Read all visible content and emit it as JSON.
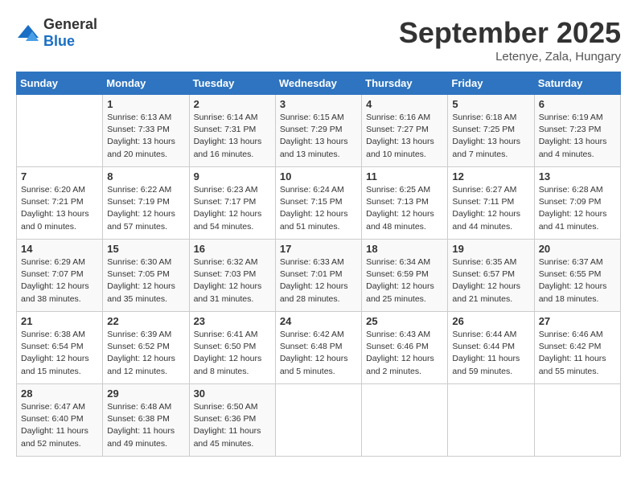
{
  "logo": {
    "general": "General",
    "blue": "Blue"
  },
  "header": {
    "month": "September 2025",
    "location": "Letenye, Zala, Hungary"
  },
  "weekdays": [
    "Sunday",
    "Monday",
    "Tuesday",
    "Wednesday",
    "Thursday",
    "Friday",
    "Saturday"
  ],
  "weeks": [
    [
      {
        "day": null,
        "info": null
      },
      {
        "day": "1",
        "info": "Sunrise: 6:13 AM\nSunset: 7:33 PM\nDaylight: 13 hours\nand 20 minutes."
      },
      {
        "day": "2",
        "info": "Sunrise: 6:14 AM\nSunset: 7:31 PM\nDaylight: 13 hours\nand 16 minutes."
      },
      {
        "day": "3",
        "info": "Sunrise: 6:15 AM\nSunset: 7:29 PM\nDaylight: 13 hours\nand 13 minutes."
      },
      {
        "day": "4",
        "info": "Sunrise: 6:16 AM\nSunset: 7:27 PM\nDaylight: 13 hours\nand 10 minutes."
      },
      {
        "day": "5",
        "info": "Sunrise: 6:18 AM\nSunset: 7:25 PM\nDaylight: 13 hours\nand 7 minutes."
      },
      {
        "day": "6",
        "info": "Sunrise: 6:19 AM\nSunset: 7:23 PM\nDaylight: 13 hours\nand 4 minutes."
      }
    ],
    [
      {
        "day": "7",
        "info": "Sunrise: 6:20 AM\nSunset: 7:21 PM\nDaylight: 13 hours\nand 0 minutes."
      },
      {
        "day": "8",
        "info": "Sunrise: 6:22 AM\nSunset: 7:19 PM\nDaylight: 12 hours\nand 57 minutes."
      },
      {
        "day": "9",
        "info": "Sunrise: 6:23 AM\nSunset: 7:17 PM\nDaylight: 12 hours\nand 54 minutes."
      },
      {
        "day": "10",
        "info": "Sunrise: 6:24 AM\nSunset: 7:15 PM\nDaylight: 12 hours\nand 51 minutes."
      },
      {
        "day": "11",
        "info": "Sunrise: 6:25 AM\nSunset: 7:13 PM\nDaylight: 12 hours\nand 48 minutes."
      },
      {
        "day": "12",
        "info": "Sunrise: 6:27 AM\nSunset: 7:11 PM\nDaylight: 12 hours\nand 44 minutes."
      },
      {
        "day": "13",
        "info": "Sunrise: 6:28 AM\nSunset: 7:09 PM\nDaylight: 12 hours\nand 41 minutes."
      }
    ],
    [
      {
        "day": "14",
        "info": "Sunrise: 6:29 AM\nSunset: 7:07 PM\nDaylight: 12 hours\nand 38 minutes."
      },
      {
        "day": "15",
        "info": "Sunrise: 6:30 AM\nSunset: 7:05 PM\nDaylight: 12 hours\nand 35 minutes."
      },
      {
        "day": "16",
        "info": "Sunrise: 6:32 AM\nSunset: 7:03 PM\nDaylight: 12 hours\nand 31 minutes."
      },
      {
        "day": "17",
        "info": "Sunrise: 6:33 AM\nSunset: 7:01 PM\nDaylight: 12 hours\nand 28 minutes."
      },
      {
        "day": "18",
        "info": "Sunrise: 6:34 AM\nSunset: 6:59 PM\nDaylight: 12 hours\nand 25 minutes."
      },
      {
        "day": "19",
        "info": "Sunrise: 6:35 AM\nSunset: 6:57 PM\nDaylight: 12 hours\nand 21 minutes."
      },
      {
        "day": "20",
        "info": "Sunrise: 6:37 AM\nSunset: 6:55 PM\nDaylight: 12 hours\nand 18 minutes."
      }
    ],
    [
      {
        "day": "21",
        "info": "Sunrise: 6:38 AM\nSunset: 6:54 PM\nDaylight: 12 hours\nand 15 minutes."
      },
      {
        "day": "22",
        "info": "Sunrise: 6:39 AM\nSunset: 6:52 PM\nDaylight: 12 hours\nand 12 minutes."
      },
      {
        "day": "23",
        "info": "Sunrise: 6:41 AM\nSunset: 6:50 PM\nDaylight: 12 hours\nand 8 minutes."
      },
      {
        "day": "24",
        "info": "Sunrise: 6:42 AM\nSunset: 6:48 PM\nDaylight: 12 hours\nand 5 minutes."
      },
      {
        "day": "25",
        "info": "Sunrise: 6:43 AM\nSunset: 6:46 PM\nDaylight: 12 hours\nand 2 minutes."
      },
      {
        "day": "26",
        "info": "Sunrise: 6:44 AM\nSunset: 6:44 PM\nDaylight: 11 hours\nand 59 minutes."
      },
      {
        "day": "27",
        "info": "Sunrise: 6:46 AM\nSunset: 6:42 PM\nDaylight: 11 hours\nand 55 minutes."
      }
    ],
    [
      {
        "day": "28",
        "info": "Sunrise: 6:47 AM\nSunset: 6:40 PM\nDaylight: 11 hours\nand 52 minutes."
      },
      {
        "day": "29",
        "info": "Sunrise: 6:48 AM\nSunset: 6:38 PM\nDaylight: 11 hours\nand 49 minutes."
      },
      {
        "day": "30",
        "info": "Sunrise: 6:50 AM\nSunset: 6:36 PM\nDaylight: 11 hours\nand 45 minutes."
      },
      {
        "day": null,
        "info": null
      },
      {
        "day": null,
        "info": null
      },
      {
        "day": null,
        "info": null
      },
      {
        "day": null,
        "info": null
      }
    ]
  ]
}
